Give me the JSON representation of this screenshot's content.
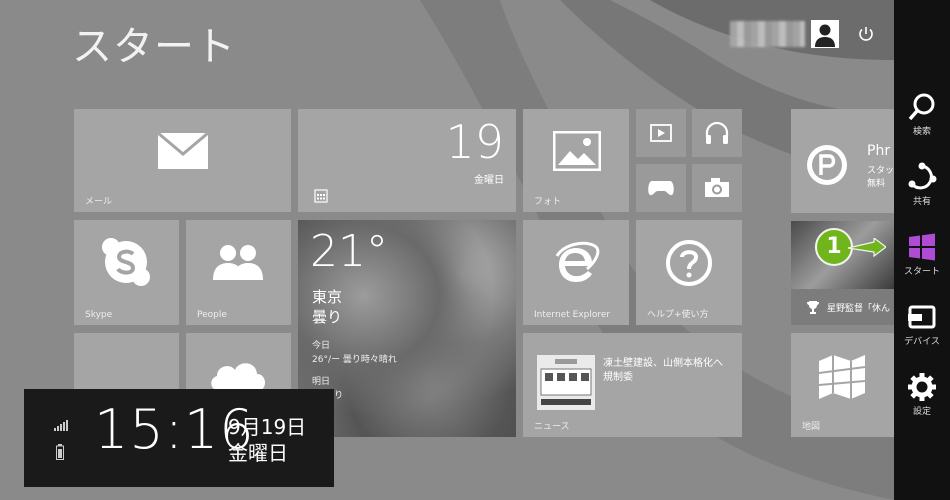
{
  "start": {
    "title": "スタート"
  },
  "tiles": {
    "mail": {
      "label": "メール"
    },
    "calendar": {
      "day": "19",
      "weekday": "金曜日"
    },
    "photos": {
      "label": "フォト"
    },
    "skype": {
      "label": "Skype"
    },
    "people": {
      "label": "People"
    },
    "weather": {
      "temp": "21°",
      "city": "東京",
      "condition": "曇り",
      "today_label": "今日",
      "today_forecast": "26°/ー 曇り時々晴れ",
      "tomorrow_label": "明日",
      "tomorrow_forecast": "9° 曇り"
    },
    "ie": {
      "label": "Internet Explorer"
    },
    "help": {
      "label": "ヘルプ+使い方"
    },
    "news": {
      "label": "ニュース",
      "headline": "凍土壁建設、山側本格化へ規制委"
    },
    "store_app": {
      "title": "Phr",
      "sub1": "スタッ",
      "sub2": "無料"
    },
    "sports": {
      "headline": "星野監督「休ん"
    },
    "maps": {
      "label": "地図"
    }
  },
  "lock": {
    "time": "15:16",
    "date": "9月19日",
    "weekday": "金曜日"
  },
  "charms": [
    {
      "label": "検索",
      "icon": "search-icon"
    },
    {
      "label": "共有",
      "icon": "share-icon"
    },
    {
      "label": "スタート",
      "icon": "windows-logo-icon"
    },
    {
      "label": "デバイス",
      "icon": "devices-icon"
    },
    {
      "label": "設定",
      "icon": "settings-gear-icon"
    }
  ],
  "annotation": {
    "step": "1"
  },
  "colors": {
    "start_charm": "#b04bd6",
    "step_marker": "#6fb51b",
    "charm_bar": "#111111"
  }
}
